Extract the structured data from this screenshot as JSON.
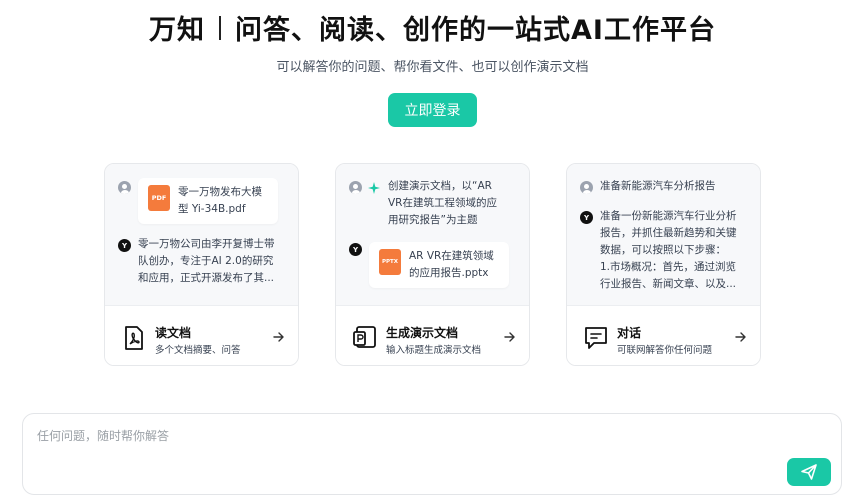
{
  "header": {
    "brand": "万知",
    "tagline": "问答、阅读、创作的一站式AI工作平台",
    "subtitle": "可以解答你的问题、帮你看文件、也可以创作演示文档",
    "login_label": "立即登录"
  },
  "colors": {
    "accent": "#1ac8a6",
    "file_icon": "#f47b3c"
  },
  "cards": [
    {
      "file_icon_text": "PDF",
      "file_name_1": "零一万物发布大模",
      "file_name_2": "型 Yi-34B.pdf",
      "bot_avatar": "Y",
      "reply_lines": [
        "零一万物公司由李开复博士带",
        "队创办，专注于AI 2.0的研究",
        "和应用，正式开源发布了其..."
      ],
      "title": "读文档",
      "desc": "多个文档摘要、问答",
      "icon": "pdf-doc-icon"
    },
    {
      "prompt_lines": [
        "创建演示文档，以“AR",
        "VR在建筑工程领域的应",
        "用研究报告”为主题"
      ],
      "bot_avatar": "Y",
      "file_icon_text": "PPTX",
      "file_name_1": "AR VR在建筑领域",
      "file_name_2": "的应用报告.pptx",
      "title": "生成演示文档",
      "desc": "输入标题生成演示文档",
      "icon": "presentation-icon"
    },
    {
      "prompt": "准备新能源汽车分析报告",
      "bot_avatar": "Y",
      "reply_lines": [
        "准备一份新能源汽车行业分析",
        "报告，并抓住最新趋势和关键",
        "数据，可以按照以下步骤：",
        "1.市场概况：首先，通过浏览",
        "行业报告、新闻文章、以及..."
      ],
      "title": "对话",
      "desc": "可联网解答你任何问题",
      "icon": "chat-icon"
    }
  ],
  "input": {
    "placeholder": "任何问题，随时帮你解答"
  }
}
